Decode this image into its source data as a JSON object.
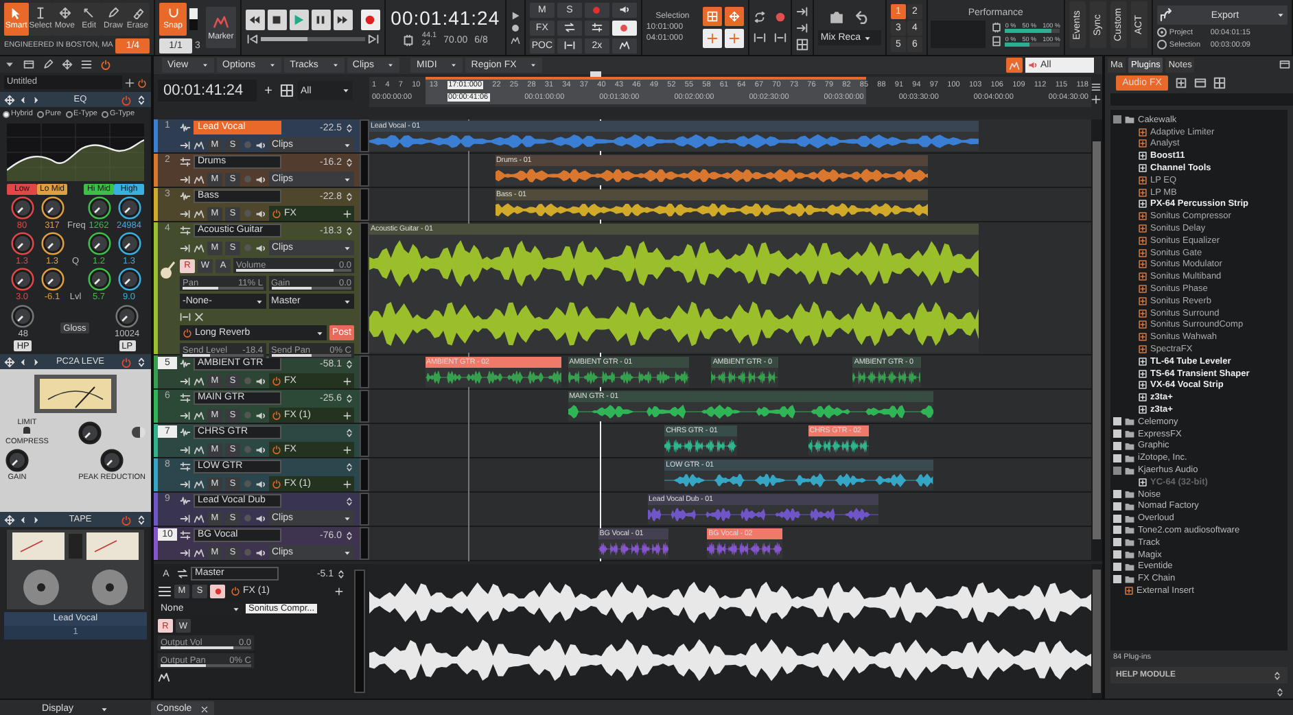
{
  "toolbar": {
    "tools": [
      {
        "label": "Smart",
        "selected": true
      },
      {
        "label": "Select",
        "selected": false
      },
      {
        "label": "Move",
        "selected": false
      },
      {
        "label": "Edit",
        "selected": false
      },
      {
        "label": "Draw",
        "selected": false
      },
      {
        "label": "Erase",
        "selected": false
      }
    ],
    "engineered": "ENGINEERED IN BOSTON, MA",
    "preset": "1/4",
    "snap": {
      "label": "Snap",
      "on": true,
      "value": "1/1",
      "extra": "3"
    },
    "marker": "Marker",
    "transport": {
      "level": 0.45
    },
    "time": "00:01:41:24",
    "sample_rate": "44.1",
    "bit_depth": "24",
    "tempo": "70.00",
    "meter": "6/8",
    "mix_buttons": [
      "M",
      "S",
      "FX",
      "POC",
      "2x"
    ],
    "selection": {
      "label": "Selection",
      "from": "10:01:000",
      "to": "04:01:000"
    },
    "mix_recall": "Mix Reca",
    "screensets": [
      {
        "label": "1",
        "selected": true
      },
      {
        "label": "2",
        "selected": false
      },
      {
        "label": "3",
        "selected": false
      },
      {
        "label": "4",
        "selected": false
      },
      {
        "label": "5",
        "selected": false
      },
      {
        "label": "6",
        "selected": false
      }
    ],
    "performance": {
      "label": "Performance",
      "meters": [
        {
          "scale": [
            "0 %",
            "50 %",
            "100 %"
          ],
          "level": 0.85
        },
        {
          "scale": [
            "0 %",
            "50 %",
            "100 %"
          ],
          "level": 0.45
        }
      ]
    },
    "modules": [
      "Events",
      "Sync",
      "Custom",
      "ACT"
    ],
    "export": {
      "label": "Export",
      "options": [
        {
          "label": "Project",
          "selected": true,
          "time": "00:04:01:15"
        },
        {
          "label": "Selection",
          "selected": false,
          "time": "00:03:00:09"
        }
      ]
    }
  },
  "menu": [
    "View",
    "Options",
    "Tracks",
    "Clips",
    "MIDI",
    "Region FX"
  ],
  "menu_filter": "All",
  "prochannel": {
    "preset": "Untitled",
    "eq": {
      "title": "EQ",
      "modes": [
        {
          "label": "Hybrid",
          "selected": true
        },
        {
          "label": "Pure",
          "selected": false
        },
        {
          "label": "E-Type",
          "selected": false
        },
        {
          "label": "G-Type",
          "selected": false
        }
      ],
      "bands": [
        {
          "label": "Low",
          "color": "#e04848",
          "freq": "80",
          "q": "1.3",
          "gain": "3.0"
        },
        {
          "label": "Lo Mid",
          "color": "#e0a040",
          "freq": "317",
          "q": "1.3",
          "gain": "-6.1"
        },
        {
          "label": "Hi Mid",
          "color": "#3cc048",
          "freq": "1262",
          "q": "1.2",
          "gain": "5.7"
        },
        {
          "label": "High",
          "color": "#38b0e0",
          "freq": "24984",
          "q": "1.3",
          "gain": "9.0"
        }
      ],
      "row_labels": [
        "Freq",
        "Q",
        "Lvl"
      ],
      "hp": {
        "label": "HP",
        "value": "48"
      },
      "lp": {
        "label": "LP",
        "value": "10024"
      },
      "gloss": "Gloss"
    },
    "comp": {
      "title": "PC2A LEVE",
      "limit": false,
      "toggle_on": true,
      "switch_top": "LIMIT",
      "switch_bottom": "COMPRESS",
      "knobs": [
        "GAIN",
        "PEAK REDUCTION"
      ]
    },
    "tape": {
      "title": "TAPE"
    },
    "track_name": "Lead Vocal",
    "track_number": "1"
  },
  "timeline": {
    "time": "00:01:41:24",
    "add": "+",
    "filter": "All",
    "selection_start": "17:01:000",
    "selection_time": "00:00:41:06",
    "measures": [
      "1",
      "4",
      "7",
      "10",
      "13",
      "22",
      "25",
      "28",
      "31",
      "34",
      "37",
      "40",
      "43",
      "46",
      "49",
      "52",
      "55",
      "58",
      "61",
      "64",
      "67",
      "70",
      "73",
      "76",
      "79",
      "82",
      "85",
      "88",
      "91",
      "94",
      "97",
      "100",
      "103",
      "106",
      "109",
      "112",
      "115",
      "118"
    ],
    "times": [
      "00:00:00:00",
      "00:01:00:00",
      "00:01:30:00",
      "00:02:00:00",
      "00:02:30:00",
      "00:03:00:00",
      "00:03:30:00",
      "00:04:00:00",
      "00:04:30:00"
    ]
  },
  "tracks": [
    {
      "number": "1",
      "buttons": [
        "M",
        "S"
      ],
      "name": "Lead Vocal",
      "selected": true,
      "number_highlighted": false,
      "volume": "-22.5",
      "color": "#3b7fd4",
      "expanded": false,
      "slot": {
        "kind": "clips",
        "label": "Clips"
      },
      "clips": [
        {
          "name": "Lead Vocal - 01",
          "selected": false
        }
      ]
    },
    {
      "number": "2",
      "buttons": [
        "M",
        "S"
      ],
      "name": "Drums",
      "selected": false,
      "number_highlighted": false,
      "volume": "-16.2",
      "color": "#d9772f",
      "expanded": false,
      "slot": {
        "kind": "clips",
        "label": "Clips"
      },
      "clips": [
        {
          "name": "Drums - 01",
          "selected": false
        }
      ]
    },
    {
      "number": "3",
      "buttons": [
        "M",
        "S"
      ],
      "name": "Bass",
      "selected": false,
      "number_highlighted": false,
      "volume": "-22.8",
      "color": "#d2aa2a",
      "expanded": false,
      "slot": {
        "kind": "fx",
        "label": "FX"
      },
      "clips": [
        {
          "name": "Bass - 01",
          "selected": false
        }
      ]
    },
    {
      "number": "4",
      "buttons": [
        "M",
        "S"
      ],
      "name": "Acoustic Guitar",
      "selected": false,
      "number_highlighted": false,
      "volume": "-18.3",
      "color": "#9bbf2a",
      "expanded": true,
      "slot": {
        "kind": "clips",
        "label": "Clips"
      },
      "details": {
        "buttons": [
          {
            "label": "R",
            "on": true
          },
          {
            "label": "W",
            "on": false
          },
          {
            "label": "A",
            "on": false
          }
        ],
        "sliders": [
          {
            "label": "Volume",
            "value": "0.0",
            "level": 0.85
          },
          {
            "label": "Pan",
            "value": "11% L",
            "level": 0.45
          },
          {
            "label": "Gain",
            "value": "0.0",
            "level": 0.5
          }
        ],
        "input": "-None-",
        "output": "Master",
        "send": {
          "name": "Long Reverb",
          "mode": "Post"
        },
        "send_sliders": [
          {
            "label": "Send Level",
            "value": "-18.4",
            "level": 0.35
          },
          {
            "label": "Send Pan",
            "value": "0% C",
            "level": 0.5
          }
        ]
      },
      "clips": [
        {
          "name": "Acoustic Guitar - 01",
          "selected": false
        }
      ]
    },
    {
      "number": "5",
      "buttons": [
        "M",
        "S"
      ],
      "name": "AMBIENT GTR",
      "selected": false,
      "number_highlighted": true,
      "volume": "-58.1",
      "color": "#36a04e",
      "expanded": false,
      "slot": {
        "kind": "fx",
        "label": "FX"
      },
      "clips": [
        {
          "name": "AMBIENT GTR - 02",
          "selected": true
        },
        {
          "name": "AMBIENT GTR - 01",
          "selected": false
        },
        {
          "name": "AMBIENT GTR - 0",
          "selected": false
        },
        {
          "name": "AMBIENT GTR - 0",
          "selected": false
        }
      ]
    },
    {
      "number": "6",
      "buttons": [
        "M",
        "S"
      ],
      "name": "MAIN GTR",
      "selected": false,
      "number_highlighted": false,
      "volume": "-25.6",
      "color": "#2fb456",
      "expanded": false,
      "slot": {
        "kind": "fx",
        "label": "FX (1)"
      },
      "clips": [
        {
          "name": "MAIN GTR - 01",
          "selected": false
        }
      ]
    },
    {
      "number": "7",
      "buttons": [
        "M",
        "S"
      ],
      "name": "CHRS GTR",
      "selected": false,
      "number_highlighted": true,
      "color": "#2fb48c",
      "expanded": false,
      "slot": {
        "kind": "fx",
        "label": "FX"
      },
      "clips": [
        {
          "name": "CHRS GTR - 01",
          "selected": false
        },
        {
          "name": "CHRS GTR - 02",
          "selected": true
        }
      ]
    },
    {
      "number": "8",
      "buttons": [
        "M",
        "S"
      ],
      "name": "LOW GTR",
      "selected": false,
      "number_highlighted": false,
      "color": "#35a6c4",
      "expanded": false,
      "slot": {
        "kind": "fx",
        "label": "FX (1)"
      },
      "clips": [
        {
          "name": "LOW GTR - 01",
          "selected": false
        }
      ]
    },
    {
      "number": "9",
      "buttons": [
        "M",
        "S"
      ],
      "name": "Lead Vocal Dub",
      "selected": false,
      "number_highlighted": false,
      "color": "#6f55c8",
      "expanded": false,
      "slot": {
        "kind": "clips",
        "label": "Clips"
      },
      "clips": [
        {
          "name": "Lead Vocal Dub - 01",
          "selected": false
        }
      ]
    },
    {
      "number": "10",
      "buttons": [
        "M",
        "S"
      ],
      "name": "BG Vocal",
      "selected": false,
      "number_highlighted": true,
      "volume": "-76.0",
      "color": "#8555cc",
      "expanded": false,
      "slot": {
        "kind": "clips",
        "label": "Clips"
      },
      "clips": [
        {
          "name": "BG Vocal - 01",
          "selected": false
        },
        {
          "name": "BG Vocal - 02",
          "selected": true
        }
      ]
    }
  ],
  "master": {
    "letter": "A",
    "name": "Master",
    "volume": "-5.1",
    "buttons": [
      "M",
      "S"
    ],
    "armed": true,
    "fx": "FX (1)",
    "plugin": "Sonitus Compr...",
    "input": "None",
    "rw": [
      {
        "label": "R",
        "on": true
      },
      {
        "label": "W",
        "on": false
      }
    ],
    "sliders": [
      {
        "label": "Output Vol",
        "value": "0.0",
        "level": 0.8
      },
      {
        "label": "Output Pan",
        "value": "0% C",
        "level": 0.5
      }
    ]
  },
  "browser": {
    "tabs": [
      {
        "label": "Ma",
        "selected": false
      },
      {
        "label": "Plugins",
        "selected": true
      },
      {
        "label": "Notes",
        "selected": false
      }
    ],
    "category": "Audio FX",
    "tree": [
      {
        "kind": "folder",
        "label": "Cakewalk",
        "expanded": true,
        "children": [
          {
            "kind": "dx",
            "label": "Adaptive Limiter"
          },
          {
            "kind": "dx",
            "label": "Analyst"
          },
          {
            "kind": "vst",
            "label": "Boost11"
          },
          {
            "kind": "vst",
            "label": "Channel Tools"
          },
          {
            "kind": "dx",
            "label": "LP EQ"
          },
          {
            "kind": "dx",
            "label": "LP MB"
          },
          {
            "kind": "vst",
            "label": "PX-64 Percussion Strip"
          },
          {
            "kind": "dx",
            "label": "Sonitus Compressor"
          },
          {
            "kind": "dx",
            "label": "Sonitus Delay"
          },
          {
            "kind": "dx",
            "label": "Sonitus Equalizer"
          },
          {
            "kind": "dx",
            "label": "Sonitus Gate"
          },
          {
            "kind": "dx",
            "label": "Sonitus Modulator"
          },
          {
            "kind": "dx",
            "label": "Sonitus Multiband"
          },
          {
            "kind": "dx",
            "label": "Sonitus Phase"
          },
          {
            "kind": "dx",
            "label": "Sonitus Reverb"
          },
          {
            "kind": "dx",
            "label": "Sonitus Surround"
          },
          {
            "kind": "dx",
            "label": "Sonitus SurroundComp"
          },
          {
            "kind": "dx",
            "label": "Sonitus Wahwah"
          },
          {
            "kind": "dx",
            "label": "SpectraFX"
          },
          {
            "kind": "vst",
            "label": "TL-64 Tube Leveler"
          },
          {
            "kind": "vst",
            "label": "TS-64 Transient Shaper"
          },
          {
            "kind": "vst",
            "label": "VX-64 Vocal Strip"
          },
          {
            "kind": "vst",
            "label": "z3ta+"
          },
          {
            "kind": "vst",
            "label": "z3ta+"
          }
        ]
      },
      {
        "kind": "folder",
        "label": "Celemony",
        "expanded": false
      },
      {
        "kind": "folder",
        "label": "ExpressFX",
        "expanded": false
      },
      {
        "kind": "folder",
        "label": "Graphic",
        "expanded": false
      },
      {
        "kind": "folder",
        "label": "iZotope, Inc.",
        "expanded": false
      },
      {
        "kind": "folder",
        "label": "Kjaerhus Audio",
        "expanded": true,
        "children": [
          {
            "kind": "vst",
            "label": "YC-64 (32-bit)",
            "disabled": true
          }
        ]
      },
      {
        "kind": "folder",
        "label": "Noise",
        "expanded": false
      },
      {
        "kind": "folder",
        "label": "Nomad Factory",
        "expanded": false
      },
      {
        "kind": "folder",
        "label": "Overloud",
        "expanded": false
      },
      {
        "kind": "folder",
        "label": "Tone2.com audiosoftware",
        "expanded": false
      },
      {
        "kind": "folder",
        "label": "Track",
        "expanded": false
      },
      {
        "kind": "folder",
        "label": "Magix",
        "expanded": false
      },
      {
        "kind": "folder",
        "label": "Eventide",
        "expanded": false
      },
      {
        "kind": "folder",
        "label": "FX Chain",
        "expanded": false
      },
      {
        "kind": "external",
        "label": "External Insert"
      }
    ],
    "count": "84 Plug-ins",
    "help": "HELP MODULE"
  },
  "bottom": {
    "display": "Display",
    "console": "Console"
  }
}
